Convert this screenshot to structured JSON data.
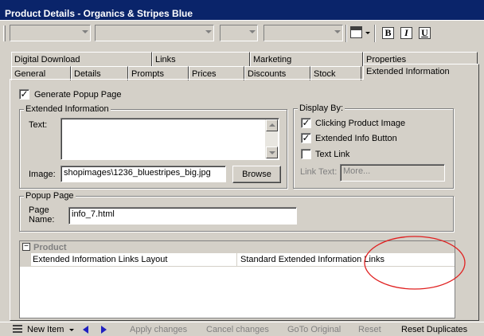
{
  "window": {
    "title": "Product Details - Organics & Stripes Blue"
  },
  "toolbar": {
    "bold": "B",
    "italic": "I",
    "underline": "U"
  },
  "tabs_back": [
    "Digital Download",
    "Links",
    "Marketing",
    "Properties"
  ],
  "tabs_front": [
    "General",
    "Details",
    "Prompts",
    "Prices",
    "Discounts",
    "Stock",
    "Extended Information"
  ],
  "form": {
    "generate_popup": {
      "label": "Generate Popup Page",
      "checked": true
    },
    "extended_info": {
      "group_label": "Extended Information",
      "text_label": "Text:",
      "image_label": "Image:",
      "image_value": "shopimages\\1236_bluestripes_big.jpg",
      "browse_label": "Browse"
    },
    "display_by": {
      "group_label": "Display By:",
      "clicking_image": {
        "label": "Clicking Product Image",
        "checked": true
      },
      "info_button": {
        "label": "Extended Info Button",
        "checked": true
      },
      "text_link": {
        "label": "Text Link",
        "checked": false
      },
      "link_text_label": "Link Text:",
      "link_text_placeholder": "More..."
    },
    "popup_page": {
      "group_label": "Popup Page",
      "name_label_1": "Page",
      "name_label_2": "Name:",
      "name_value": "info_7.html"
    }
  },
  "property_grid": {
    "expander": "−",
    "category": "Product",
    "row_name": "Extended Information Links Layout",
    "row_value": "Standard Extended Information Links"
  },
  "statusbar": {
    "new_item": "New Item",
    "apply": "Apply changes",
    "cancel": "Cancel changes",
    "goto_original": "GoTo Original",
    "reset": "Reset",
    "reset_duplicates": "Reset Duplicates"
  },
  "colors": {
    "titlebar": "#0a246a",
    "annotation": "#e02020",
    "nav_arrow": "#2020c0"
  }
}
